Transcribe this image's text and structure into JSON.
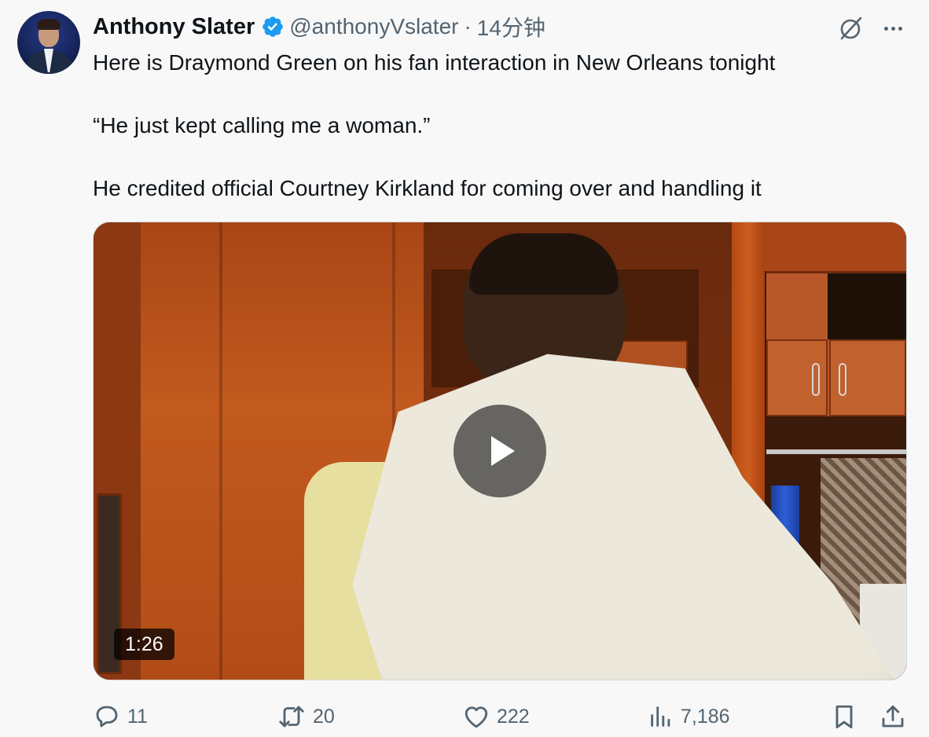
{
  "tweet": {
    "author": "Anthony Slater",
    "handle": "@anthonyVslater",
    "separator": "·",
    "time": "14分钟",
    "paragraphs": [
      "Here is Draymond Green on his fan interaction in New Orleans tonight",
      "“He just kept calling me a woman.”",
      "He credited official Courtney Kirkland for coming over and handling it"
    ]
  },
  "media": {
    "duration": "1:26"
  },
  "actions": {
    "replies": "11",
    "reposts": "20",
    "likes": "222",
    "views": "7,186"
  },
  "colors": {
    "verified": "#1d9bf0",
    "text": "#0f1419",
    "secondary": "#536471",
    "background": "#f8f8f8"
  },
  "icons": [
    "verified-badge-icon",
    "grok-icon",
    "more-icon",
    "play-icon",
    "reply-icon",
    "repost-icon",
    "like-icon",
    "views-icon",
    "bookmark-icon",
    "share-icon"
  ]
}
